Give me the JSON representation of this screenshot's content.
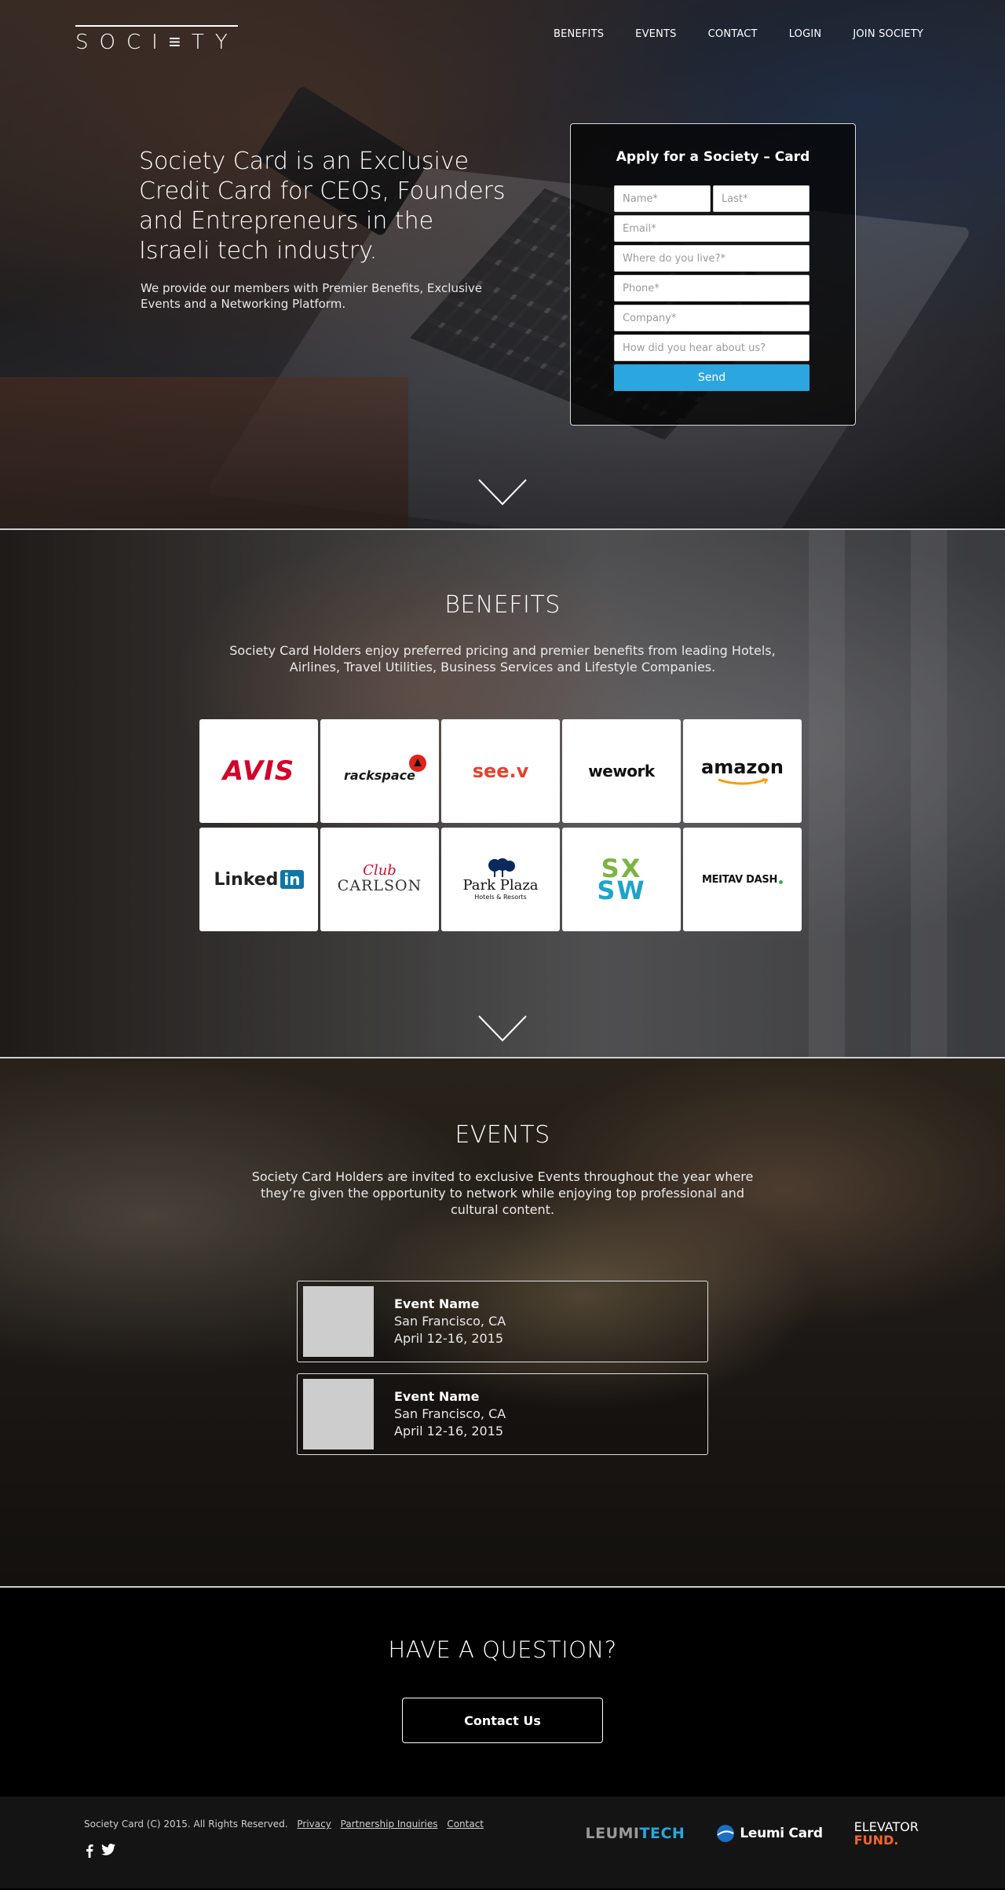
{
  "header": {
    "logo_text": "SOCI≡TY",
    "nav": [
      "BENEFITS",
      "EVENTS",
      "CONTACT",
      "LOGIN",
      "JOIN SOCIETY"
    ]
  },
  "hero": {
    "title": "Society Card is an Exclusive Credit Card for CEOs, Founders and Entrepreneurs in the Israeli tech industry.",
    "subtitle": "We provide our members with Premier Benefits, Exclusive Events and a Networking Platform."
  },
  "apply_form": {
    "title": "Apply for a Society – Card",
    "placeholders": {
      "name": "Name*",
      "last": "Last*",
      "email": "Email*",
      "location": "Where do you live?*",
      "phone": "Phone*",
      "company": "Company*",
      "referral": "How did you hear about us?"
    },
    "send_label": "Send"
  },
  "benefits": {
    "title": "BENEFITS",
    "text": "Society Card Holders enjoy preferred pricing and premier benefits from leading Hotels, Airlines, Travel Utilities, Business Services and Lifestyle Companies.",
    "partners": [
      {
        "name": "AVIS",
        "color": "#d4002a"
      },
      {
        "name": "rackspace",
        "color": "#1a1a1a"
      },
      {
        "name": "see.v",
        "color": "#e8412c"
      },
      {
        "name": "wework",
        "color": "#111111"
      },
      {
        "name": "amazon",
        "color": "#111111"
      },
      {
        "name": "Linked",
        "suffix": "in",
        "color": "#0e76a8"
      },
      {
        "name": "Club",
        "sub": "CARLSON",
        "color": "#c8102e"
      },
      {
        "name": "Park Plaza",
        "sub": "Hotels & Resorts",
        "color": "#0a2a5c"
      },
      {
        "name": "SX",
        "sub": "SW",
        "color": "#7cb342"
      },
      {
        "name": "MEITAV DASH",
        "color": "#111111"
      }
    ]
  },
  "events": {
    "title": "EVENTS",
    "text": "Society Card Holders are invited to exclusive Events throughout the year where they’re given the opportunity to network  while enjoying top professional and cultural content.",
    "items": [
      {
        "name": "Event Name",
        "location": "San Francisco, CA",
        "date": "April 12-16, 2015"
      },
      {
        "name": "Event Name",
        "location": "San Francisco, CA",
        "date": "April 12-16, 2015"
      }
    ]
  },
  "question": {
    "title": "HAVE A QUESTION?",
    "button_label": "Contact Us"
  },
  "footer": {
    "copyright": "Society Card (C) 2015. All Rights Reserved.",
    "links": [
      "Privacy",
      "Partnership Inquiries",
      "Contact"
    ],
    "social": [
      "facebook-icon",
      "twitter-icon"
    ],
    "partners": {
      "leumitech_a": "LEUMI",
      "leumitech_b": "TECH",
      "leumicard": "Leumi Card",
      "elevator_a": "ELEVATOR",
      "elevator_b": "FUND."
    }
  },
  "colors": {
    "accent": "#2ba6de",
    "elevator_orange": "#f2662a"
  }
}
